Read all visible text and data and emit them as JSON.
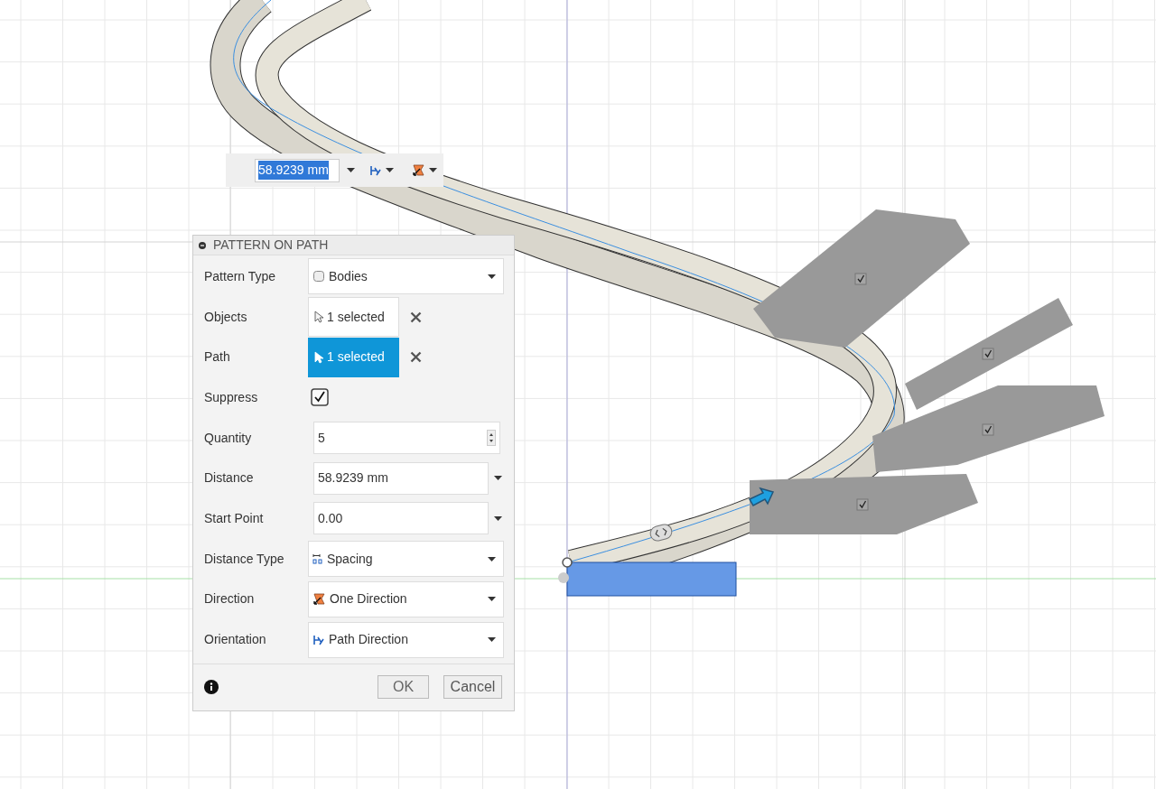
{
  "distance_toolbar": {
    "value": "58.9239 mm",
    "value_selected": true
  },
  "dialog": {
    "title": "PATTERN ON PATH",
    "fields": [
      {
        "kind": "dropdown",
        "label": "Pattern Type",
        "value": "Bodies"
      },
      {
        "kind": "selection",
        "label": "Objects",
        "value": "1 selected",
        "selected": false
      },
      {
        "kind": "selection",
        "label": "Path",
        "value": "1 selected",
        "selected": true
      },
      {
        "kind": "checkbox",
        "label": "Suppress",
        "checked": true
      },
      {
        "kind": "spinner",
        "label": "Quantity",
        "value": "5"
      },
      {
        "kind": "input_dropdown",
        "label": "Distance",
        "value": "58.9239 mm"
      },
      {
        "kind": "input_dropdown",
        "label": "Start Point",
        "value": "0.00"
      },
      {
        "kind": "dropdown",
        "label": "Distance Type",
        "value": "Spacing"
      },
      {
        "kind": "dropdown",
        "label": "Direction",
        "value": "One Direction"
      },
      {
        "kind": "dropdown",
        "label": "Orientation",
        "value": "Path Direction"
      }
    ],
    "buttons": [
      "OK",
      "Cancel"
    ]
  },
  "preview_bodies": [
    {
      "checked": true
    },
    {
      "checked": true
    },
    {
      "checked": true
    },
    {
      "checked": true
    }
  ]
}
